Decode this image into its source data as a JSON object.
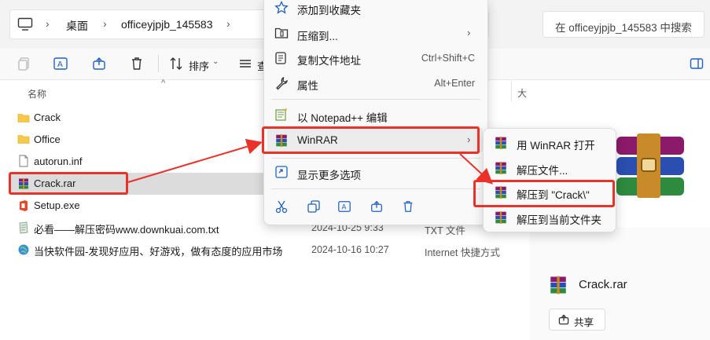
{
  "address": {
    "crumbs": [
      "桌面",
      "officeyjpjb_145583"
    ],
    "search_placeholder": "在 officeyjpjb_145583 中搜索"
  },
  "toolbar": {
    "sort_label": "排序",
    "view_label_partial": "查"
  },
  "columns": {
    "name": "名称",
    "size_partial": "大"
  },
  "files": [
    {
      "name": "Crack",
      "icon": "folder-icon",
      "date": "",
      "type": ""
    },
    {
      "name": "Office",
      "icon": "folder-icon",
      "date": "",
      "type": ""
    },
    {
      "name": "autorun.inf",
      "icon": "file-icon",
      "date": "",
      "type": ""
    },
    {
      "name": "Crack.rar",
      "icon": "winrar-icon",
      "date": "",
      "type": ""
    },
    {
      "name": "Setup.exe",
      "icon": "office-setup-icon",
      "date": "",
      "type": ""
    },
    {
      "name": "必看——解压密码www.downkuai.com.txt",
      "icon": "text-file-icon",
      "date": "2024-10-25 9:33",
      "type": "TXT 文件"
    },
    {
      "name": "当快软件园-发现好应用、好游戏，做有态度的应用市场",
      "icon": "internet-shortcut-icon",
      "date": "2024-10-16 10:27",
      "type": "Internet 快捷方式"
    }
  ],
  "context_menu": {
    "add_favorites": "添加到收藏夹",
    "compress_to": "压缩到...",
    "copy_path": "复制文件地址",
    "copy_path_shortcut": "Ctrl+Shift+C",
    "properties": "属性",
    "properties_shortcut": "Alt+Enter",
    "notepad": "以 Notepad++ 编辑",
    "winrar": "WinRAR",
    "more_options": "显示更多选项"
  },
  "submenu": {
    "open_with": "用 WinRAR 打开",
    "extract_files": "解压文件...",
    "extract_to_crack": "解压到 \"Crack\\\"",
    "extract_here": "解压到当前文件夹"
  },
  "preview": {
    "filename": "Crack.rar",
    "share": "共享"
  },
  "colors": {
    "highlight_red": "#e8322a",
    "folder_yellow": "#f7c948",
    "selection_gray": "#dcdcdc"
  }
}
